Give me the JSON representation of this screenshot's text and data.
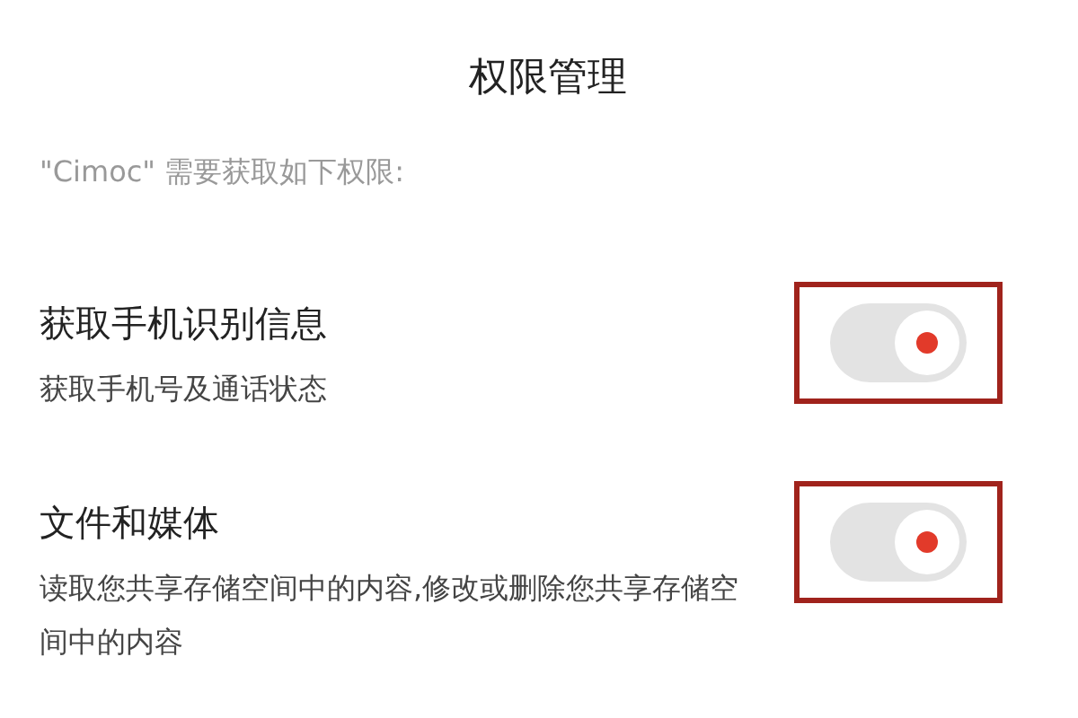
{
  "title": "权限管理",
  "subtitle": "\"Cimoc\" 需要获取如下权限:",
  "permissions": [
    {
      "name": "获取手机识别信息",
      "description": "获取手机号及通话状态",
      "on": true,
      "highlighted": true
    },
    {
      "name": "文件和媒体",
      "description": "读取您共享存储空间中的内容,修改或删除您共享存储空间中的内容",
      "on": true,
      "highlighted": true
    }
  ]
}
